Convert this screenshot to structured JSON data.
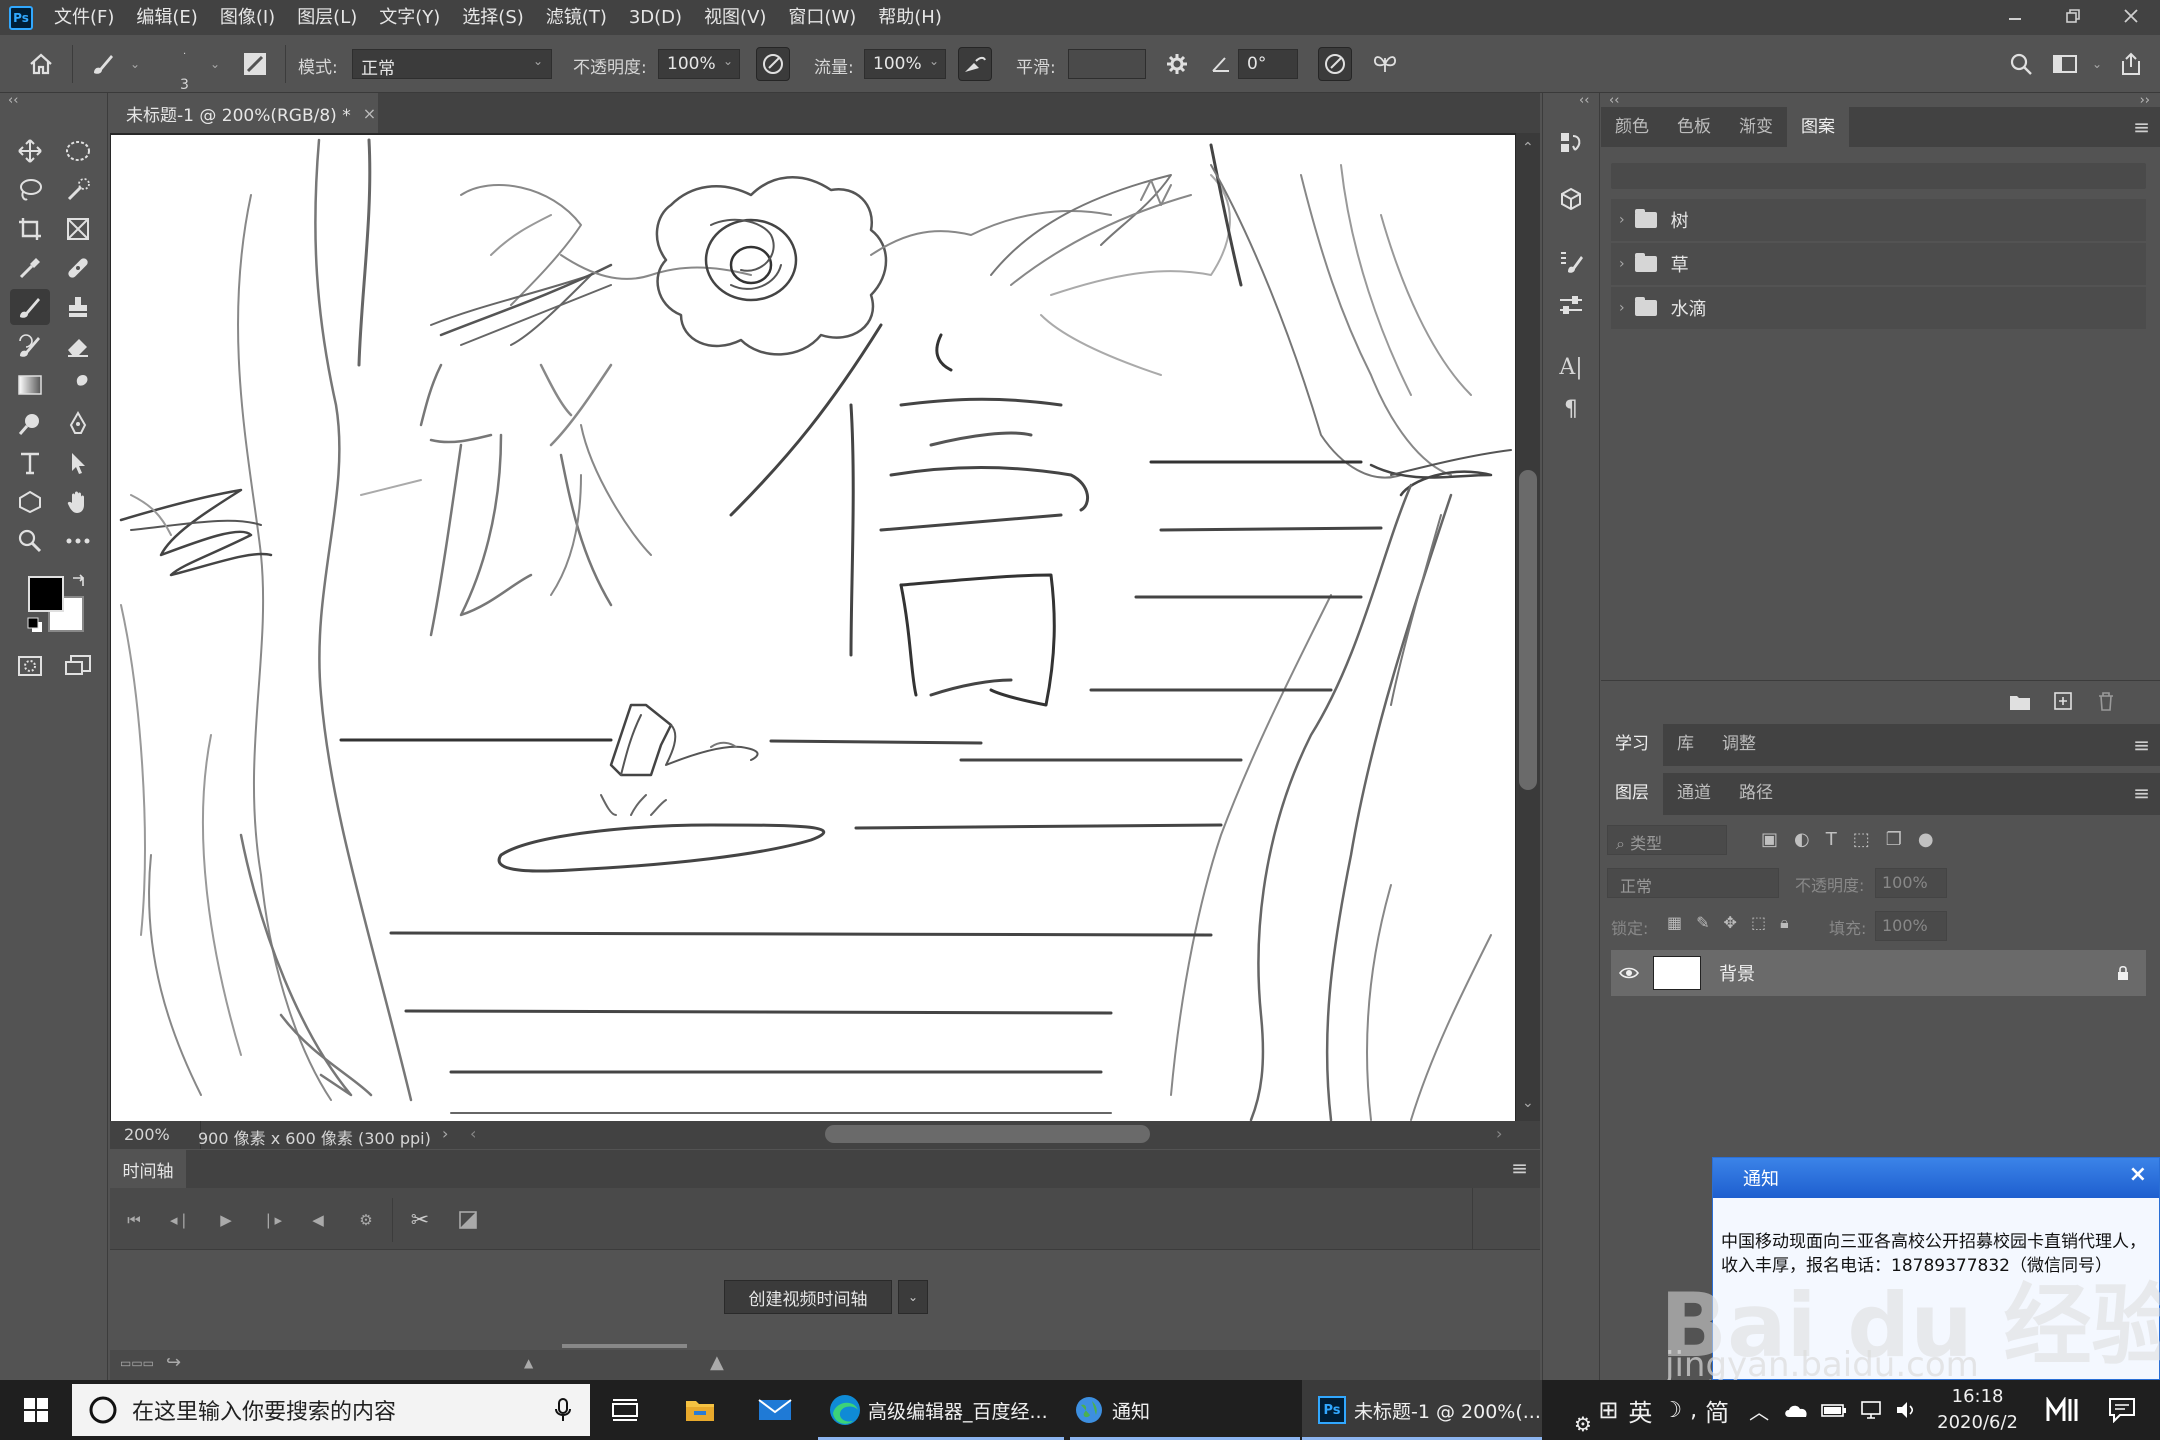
{
  "menu": {
    "logo": "Ps",
    "items": [
      "文件(F)",
      "编辑(E)",
      "图像(I)",
      "图层(L)",
      "文字(Y)",
      "选择(S)",
      "滤镜(T)",
      "3D(D)",
      "视图(V)",
      "窗口(W)",
      "帮助(H)"
    ]
  },
  "options": {
    "brush_size": "3",
    "mode_label": "模式:",
    "mode_value": "正常",
    "opacity_label": "不透明度:",
    "opacity_value": "100%",
    "flow_label": "流量:",
    "flow_value": "100%",
    "smooth_label": "平滑:",
    "smooth_value": "",
    "angle_value": "0°"
  },
  "document": {
    "tab_title": "未标题-1 @ 200%(RGB/8) *",
    "tab_close": "×",
    "zoom": "200%",
    "info": "900 像素 x 600 像素 (300 ppi)"
  },
  "timeline": {
    "tab": "时间轴",
    "create_button": "创建视频时间轴"
  },
  "patterns_panel": {
    "tabs": [
      "颜色",
      "色板",
      "渐变",
      "图案"
    ],
    "active_tab": "图案",
    "groups": [
      "树",
      "草",
      "水滴"
    ]
  },
  "learn_panel": {
    "tabs": [
      "学习",
      "库",
      "调整"
    ]
  },
  "layers_panel": {
    "tabs": [
      "图层",
      "通道",
      "路径"
    ],
    "filter_placeholder": "类型",
    "blend_mode": "正常",
    "opacity_label": "不透明度:",
    "opacity_value": "100%",
    "lock_label": "锁定:",
    "fill_label": "填充:",
    "fill_value": "100%",
    "layers": [
      {
        "name": "背景",
        "locked": true
      }
    ]
  },
  "notification": {
    "title": "通知",
    "close": "×",
    "body": "中国移动现面向三亚各高校公开招募校园卡直销代理人，收入丰厚，报名电话：18789377832（微信同号）"
  },
  "watermark": {
    "main": "Bai du 经验",
    "sub": "jingyan.baidu.com"
  },
  "taskbar": {
    "search_placeholder": "在这里输入你要搜索的内容",
    "apps": [
      "高级编辑器_百度经...",
      "通知",
      "未标题-1 @ 200%(..."
    ],
    "ime": "英",
    "ime2": "简",
    "time": "16:18",
    "date": "2020/6/2"
  },
  "colors": {
    "accent": "#31a8ff",
    "panel_bg": "#535353",
    "dark_bg": "#424242",
    "notify_head": "#1e5fcf"
  }
}
